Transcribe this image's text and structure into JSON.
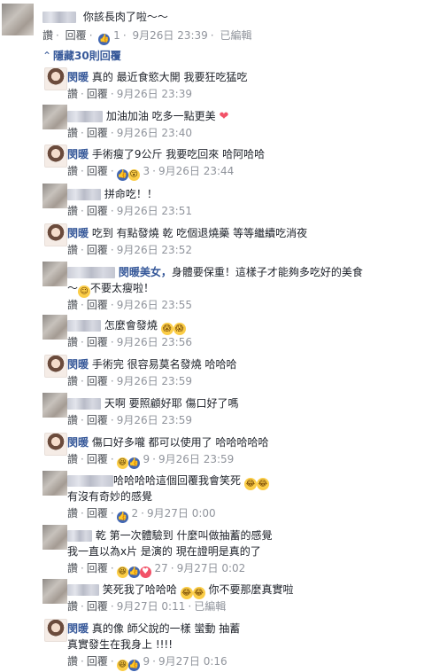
{
  "post": {
    "comment_text": "你該長肉了啦～～",
    "actions": {
      "like": "讚",
      "reply": "回覆",
      "like_count": "1",
      "time": "9月26日 23:39",
      "edited": "已編輯"
    }
  },
  "hidden_replies_label": "隱藏30則回覆",
  "replies": [
    {
      "name": "閔暖",
      "text": "真的 最近食慾大開 我要狂吃猛吃",
      "time": "9月26日 23:39"
    },
    {
      "name": "",
      "text": "加油加油 吃多一點更美",
      "time": "9月26日 23:40"
    },
    {
      "name": "閔暖",
      "text": "手術瘦了9公斤 我要吃回來 哈阿哈哈",
      "time": "9月26日 23:44",
      "reaction_count": "3"
    },
    {
      "name": "",
      "text": "拼命吃！！",
      "time": "9月26日 23:51"
    },
    {
      "name": "閔暖",
      "text": "吃到 有點發燒 乾 吃個退燒藥 等等繼續吃消夜",
      "time": "9月26日 23:52"
    },
    {
      "name": "閔暖美女，",
      "text_line1": "身體要保重！這樣子才能夠多吃好的美食",
      "text_line2": "不要太瘦啦！",
      "time": "9月26日 23:55"
    },
    {
      "name": "",
      "text": "怎麼會發燒",
      "time": "9月26日 23:56"
    },
    {
      "name": "閔暖",
      "text": "手術完 很容易莫名發燒 哈哈哈",
      "time": "9月26日 23:59"
    },
    {
      "name": "",
      "text": "天啊 要照顧好耶 傷口好了嗎",
      "time": "9月26日 23:59"
    },
    {
      "name": "閔暖",
      "text": "傷口好多嚨 都可以使用了 哈哈哈哈哈",
      "time": "9月26日 23:59",
      "reaction_count": "9"
    },
    {
      "name": "",
      "text_line1": "哈哈哈哈這個回覆我會笑死",
      "text_line2": "有沒有奇妙的感覺",
      "time": "9月27日 0:00",
      "reaction_count": "2"
    },
    {
      "name": "乾",
      "text_line1": "第一次體驗到 什麼叫做抽蓄的感覺",
      "text_line2": "我一直以為x片 是演的 現在證明是真的了",
      "time": "9月27日 0:02",
      "reaction_count": "27"
    },
    {
      "name": "",
      "text": "笑死我了哈哈哈",
      "text_extra": "你不要那麼真實啦",
      "time": "9月27日 0:11",
      "edited": "已編輯"
    },
    {
      "name": "閔暖",
      "text_line1": "真的像 師父說的一樣 蠻動 抽蓄",
      "text_line2": "真實發生在我身上 !!!!",
      "time": "9月27日 0:16",
      "reaction_count": "9"
    }
  ],
  "labels": {
    "like": "讚",
    "reply": "回覆",
    "sep": "·"
  },
  "colors": {
    "link": "#365899",
    "meta": "#90949c",
    "like_blue": "#4267b2"
  }
}
